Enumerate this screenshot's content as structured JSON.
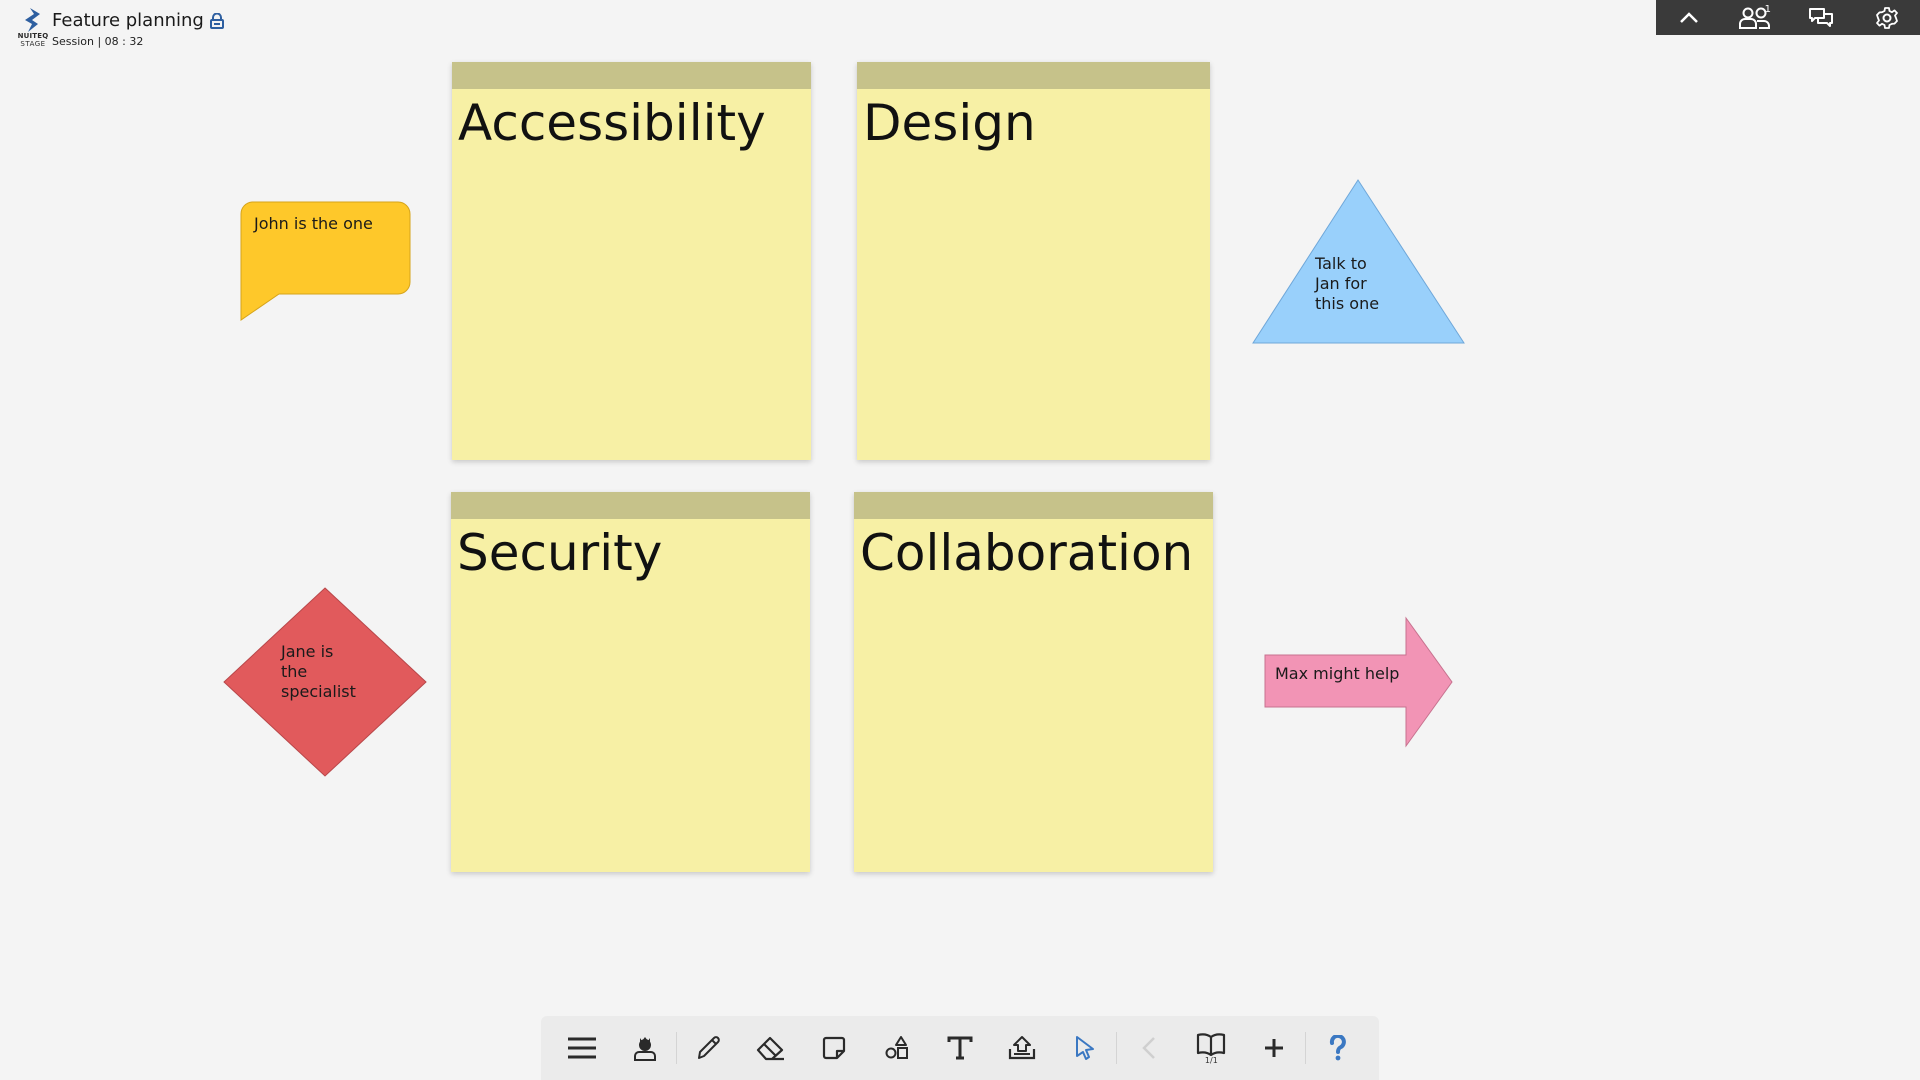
{
  "app": {
    "logo_line1": "NUITEQ",
    "logo_line2": "STAGE",
    "title": "Feature planning",
    "title_icon": "lock-icon",
    "session_label": "Session | 08 : 32"
  },
  "topbar": {
    "items": [
      {
        "name": "collapse",
        "icon": "chevron-up-icon"
      },
      {
        "name": "participants",
        "icon": "users-icon",
        "badge": "1"
      },
      {
        "name": "chat",
        "icon": "chat-icon"
      },
      {
        "name": "settings",
        "icon": "gear-icon"
      }
    ]
  },
  "canvas": {
    "notes": [
      {
        "title": "Accessibility",
        "color": "#f7f0a5",
        "header_color": "#c6c28a"
      },
      {
        "title": "Design",
        "color": "#f7f0a5",
        "header_color": "#c6c28a"
      },
      {
        "title": "Security",
        "color": "#f7f0a5",
        "header_color": "#c6c28a"
      },
      {
        "title": "Collaboration",
        "color": "#f7f0a5",
        "header_color": "#c6c28a"
      }
    ],
    "shapes": {
      "speech_bubble": {
        "text": "John is the one",
        "color": "#fec82a"
      },
      "triangle": {
        "lines": [
          "Talk to",
          "Jan for",
          "this one"
        ],
        "color": "#99d0fb"
      },
      "diamond": {
        "lines": [
          "Jane is",
          "the",
          "specialist"
        ],
        "color": "#e15a5c"
      },
      "arrow": {
        "text": "Max might help",
        "color": "#f294b5"
      }
    }
  },
  "toolbar": {
    "items": [
      {
        "name": "menu",
        "icon": "menu-icon"
      },
      {
        "name": "host",
        "icon": "host-icon"
      },
      {
        "name": "pen",
        "icon": "pencil-icon"
      },
      {
        "name": "eraser",
        "icon": "eraser-icon"
      },
      {
        "name": "sticky-note",
        "icon": "sticky-note-icon"
      },
      {
        "name": "shapes",
        "icon": "shapes-icon"
      },
      {
        "name": "text",
        "icon": "text-icon"
      },
      {
        "name": "upload",
        "icon": "upload-icon"
      },
      {
        "name": "select",
        "icon": "cursor-icon",
        "active": true
      },
      {
        "name": "previous",
        "icon": "chevron-left-icon",
        "disabled": true
      },
      {
        "name": "pages",
        "icon": "book-icon",
        "page_indicator": "1/1"
      },
      {
        "name": "add-page",
        "icon": "plus-icon"
      },
      {
        "name": "help",
        "icon": "help-icon"
      }
    ],
    "accent_color": "#3b78c2"
  }
}
